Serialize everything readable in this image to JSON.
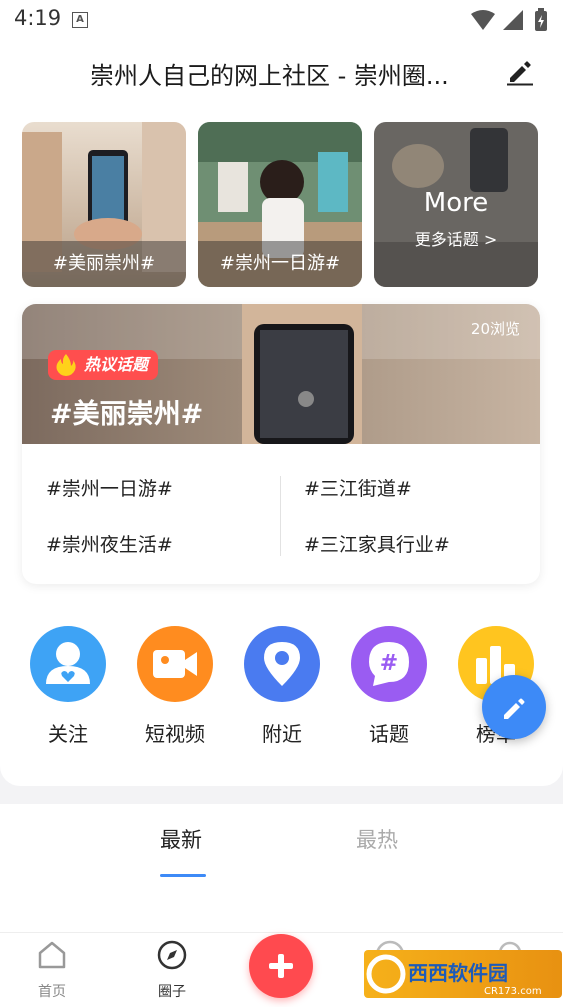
{
  "status": {
    "time": "4:19",
    "a_icon": "A"
  },
  "header": {
    "title": "崇州人自己的网上社区 - 崇州圈..."
  },
  "topic_tiles": [
    {
      "label": "#美丽崇州#"
    },
    {
      "label": "#崇州一日游#"
    },
    {
      "title": "More",
      "subtitle": "更多话题 >"
    }
  ],
  "hot": {
    "views": "20浏览",
    "badge": "热议话题",
    "title": "#美丽崇州#",
    "links": [
      "#崇州一日游#",
      "#三江街道#",
      "#崇州夜生活#",
      "#三江家具行业#"
    ]
  },
  "nav": [
    {
      "label": "关注",
      "icon": "follow-user-icon"
    },
    {
      "label": "短视频",
      "icon": "video-icon"
    },
    {
      "label": "附近",
      "icon": "location-icon"
    },
    {
      "label": "话题",
      "icon": "topic-hash-icon"
    },
    {
      "label": "榜单",
      "icon": "ranking-icon"
    }
  ],
  "feed_tabs": {
    "latest": "最新",
    "hot": "最热"
  },
  "bottom_nav": [
    {
      "label": "首页",
      "icon": "home-icon"
    },
    {
      "label": "圈子",
      "icon": "compass-icon"
    }
  ],
  "watermark": {
    "text": "西西软件园",
    "sub": "CR173.com"
  },
  "colors": {
    "accent": "#3d8af7",
    "hot_red": "#ff4e4e",
    "add_red": "#ff4a4f"
  }
}
